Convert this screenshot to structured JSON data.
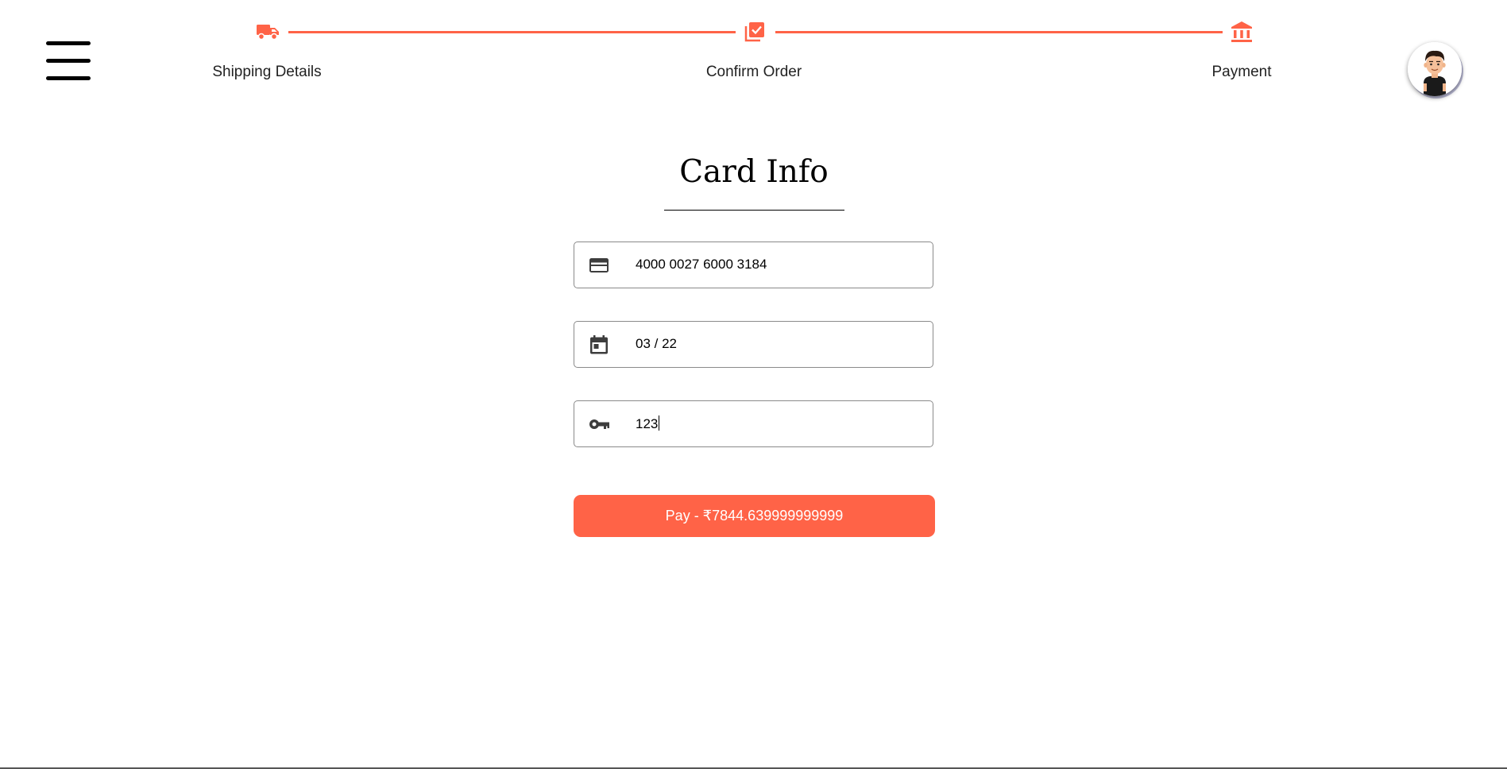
{
  "stepper": {
    "steps": [
      {
        "label": "Shipping Details",
        "icon": "truck-icon"
      },
      {
        "label": "Confirm Order",
        "icon": "library-add-check-icon"
      },
      {
        "label": "Payment",
        "icon": "bank-icon"
      }
    ],
    "accent_color": "#ff6347"
  },
  "header": {
    "menu_icon": "hamburger-menu-icon",
    "avatar_icon": "user-avatar"
  },
  "form": {
    "title": "Card Info",
    "card_number": {
      "icon": "credit-card-icon",
      "value": "4000 0027 6000 3184"
    },
    "expiry": {
      "icon": "calendar-icon",
      "value": "03 / 22"
    },
    "cvc": {
      "icon": "key-icon",
      "value": "123"
    },
    "pay_button_label": "Pay - ₹7844.639999999999"
  }
}
